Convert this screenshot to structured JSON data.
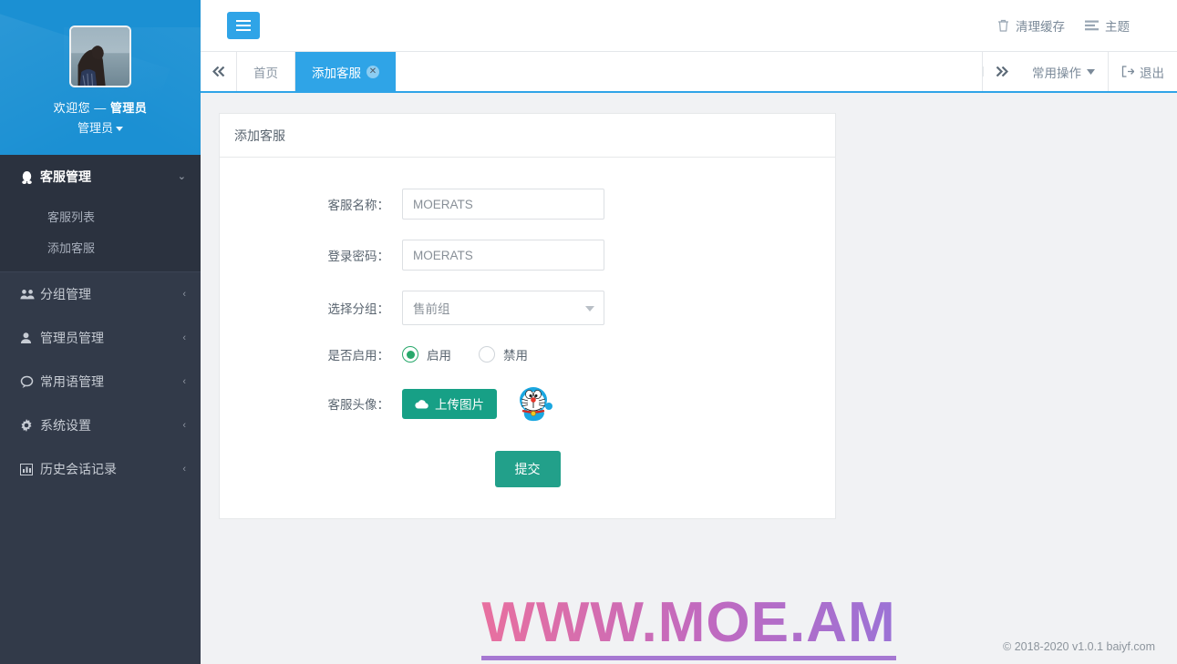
{
  "sidebar": {
    "user": {
      "welcome_prefix": "欢迎您 — ",
      "welcome_name": "管理员",
      "dropdown_label": "管理员"
    },
    "items": [
      {
        "label": "客服管理",
        "icon": "penguin-icon",
        "open": true,
        "children": [
          {
            "label": "客服列表"
          },
          {
            "label": "添加客服"
          }
        ]
      },
      {
        "label": "分组管理",
        "icon": "users-icon",
        "open": false
      },
      {
        "label": "管理员管理",
        "icon": "user-icon",
        "open": false
      },
      {
        "label": "常用语管理",
        "icon": "comment-icon",
        "open": false
      },
      {
        "label": "系统设置",
        "icon": "gear-icon",
        "open": false
      },
      {
        "label": "历史会话记录",
        "icon": "chart-bar-icon",
        "open": false
      }
    ]
  },
  "topbar": {
    "menu_toggle": "hamburger-icon",
    "links": [
      {
        "label": "清理缓存",
        "icon": "trash-icon"
      },
      {
        "label": "主题",
        "icon": "theme-icon"
      }
    ]
  },
  "tabbar": {
    "prev_icon": "double-chevron-left-icon",
    "next_icon": "double-chevron-right-icon",
    "tabs": [
      {
        "label": "首页",
        "active": false,
        "closable": false
      },
      {
        "label": "添加客服",
        "active": true,
        "closable": true
      }
    ],
    "actions": [
      {
        "label": "常用操作",
        "icon": "caret-down-icon"
      },
      {
        "label": "退出",
        "icon": "logout-icon"
      }
    ]
  },
  "panel": {
    "title": "添加客服",
    "fields": {
      "name_label": "客服名称：",
      "name_value": "MOERATS",
      "password_label": "登录密码：",
      "password_value": "MOERATS",
      "group_label": "选择分组：",
      "group_value": "售前组",
      "enable_label": "是否启用：",
      "enable_on": "启用",
      "enable_off": "禁用",
      "avatar_label": "客服头像：",
      "upload_button": "上传图片"
    },
    "submit_label": "提交"
  },
  "watermark": {
    "text": "WWW.MOE.AM"
  },
  "footer": {
    "text": "© 2018-2020 v1.0.1 baiyf.com"
  },
  "colors": {
    "sidebar_bg": "#323a49",
    "sidebar_head": "#1b90d3",
    "accent_blue": "#2fa4e7",
    "green": "#17a086",
    "radio_green": "#28a86b",
    "content_bg": "#f1f2f4"
  }
}
